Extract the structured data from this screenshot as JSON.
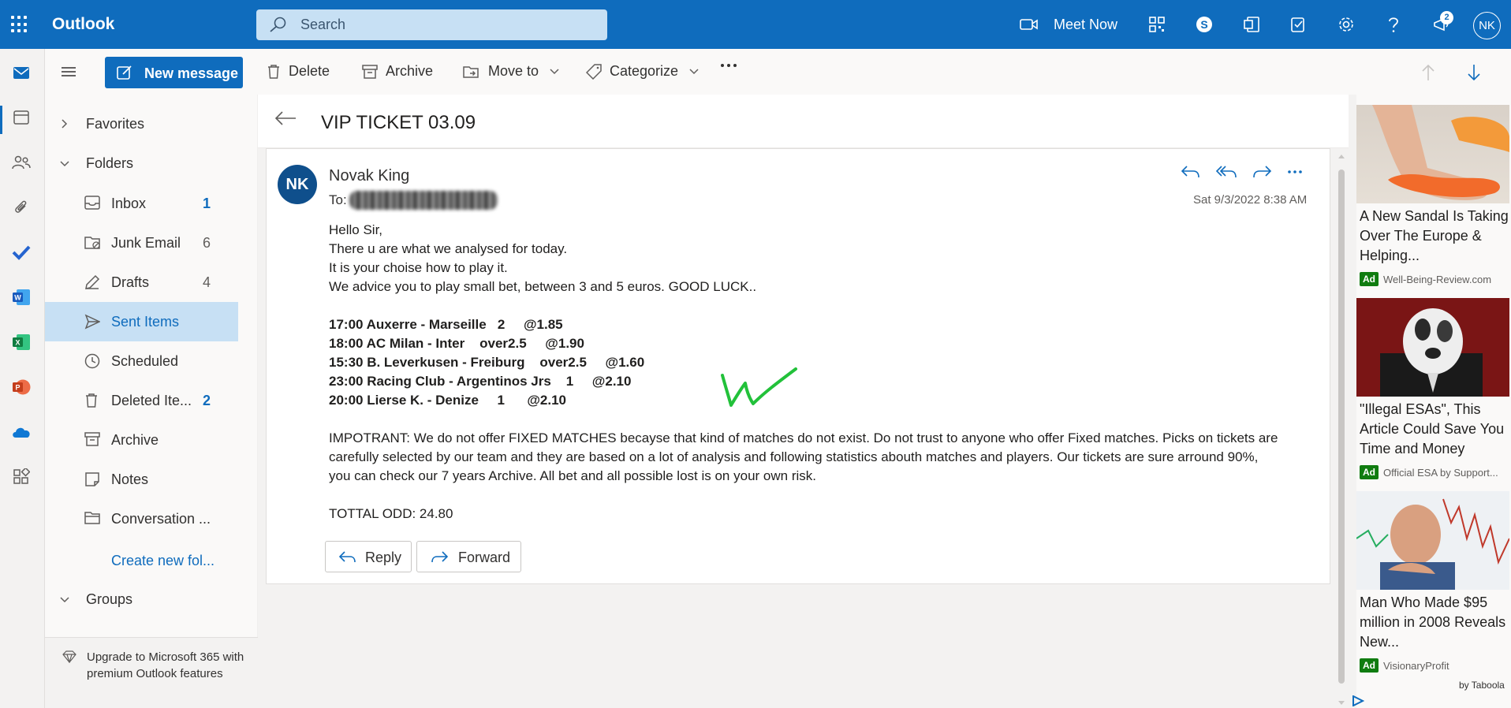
{
  "app": {
    "name": "Outlook",
    "search_placeholder": "Search",
    "meet_now_label": "Meet Now",
    "notification_count": "2",
    "user_initials": "NK"
  },
  "toolbar": {
    "new_message": "New message",
    "delete": "Delete",
    "archive": "Archive",
    "move_to": "Move to",
    "categorize": "Categorize"
  },
  "nav": {
    "favorites": "Favorites",
    "folders_header": "Folders",
    "groups": "Groups",
    "folders": [
      {
        "label": "Inbox",
        "count": "1",
        "icon": "inbox-icon"
      },
      {
        "label": "Junk Email",
        "count": "6",
        "icon": "junk-icon"
      },
      {
        "label": "Drafts",
        "count": "4",
        "icon": "drafts-icon"
      },
      {
        "label": "Sent Items",
        "count": "",
        "icon": "sent-icon"
      },
      {
        "label": "Scheduled",
        "count": "",
        "icon": "clock-icon"
      },
      {
        "label": "Deleted Ite...",
        "count": "2",
        "icon": "trash-icon"
      },
      {
        "label": "Archive",
        "count": "",
        "icon": "archive-icon"
      },
      {
        "label": "Notes",
        "count": "",
        "icon": "notes-icon"
      },
      {
        "label": "Conversation ...",
        "count": "",
        "icon": "folder-icon"
      }
    ],
    "create_folder": "Create new fol...",
    "upgrade": "Upgrade to Microsoft 365 with premium Outlook features"
  },
  "message": {
    "subject": "VIP TICKET 03.09",
    "sender_initials": "NK",
    "sender_name": "Novak King",
    "to_label": "To:",
    "date": "Sat 9/3/2022 8:38 AM",
    "greeting": "Hello Sir,",
    "intro_lines": [
      "There u are what we analysed for today.",
      "It is your choise how to play it.",
      "We advice you to play small bet, between 3 and 5 euros. GOOD LUCK.."
    ],
    "picks": [
      "17:00 Auxerre - Marseille   2     @1.85",
      "18:00 AC Milan - Inter    over2.5     @1.90",
      "15:30 B. Leverkusen - Freiburg    over2.5     @1.60",
      "23:00 Racing Club - Argentinos Jrs    1     @2.10",
      "20:00 Lierse K. - Denize     1      @2.10"
    ],
    "disclaimer": "IMPOTRANT: We do not offer FIXED MATCHES becayse that kind of matches do not exist. Do not trust to anyone who offer Fixed matches. Picks on tickets are carefully selected by our team and they are based on a lot of analysis and following statistics abouth matches and players. Our tickets are sure arround 90%, you can check our 7 years Archive. All bet and all possible lost is on your own risk.",
    "total": "TOTTAL ODD: 24.80",
    "reply": "Reply",
    "forward": "Forward"
  },
  "ads": [
    {
      "title": "A New Sandal Is Taking Over The Europe & Helping...",
      "tag": "Ad",
      "source": "Well-Being-Review.com"
    },
    {
      "title": "\"Illegal ESAs\", This Article Could Save You Time and Money",
      "tag": "Ad",
      "source": "Official ESA by Support..."
    },
    {
      "title": "Man Who Made $95 million in 2008 Reveals New...",
      "tag": "Ad",
      "source": "VisionaryProfit"
    }
  ],
  "ads_footer": "by Taboola",
  "colors": {
    "brand": "#0f6cbd",
    "selected": "#c7e0f4",
    "ad_tag": "#107c10",
    "tick": "#22c13a"
  }
}
